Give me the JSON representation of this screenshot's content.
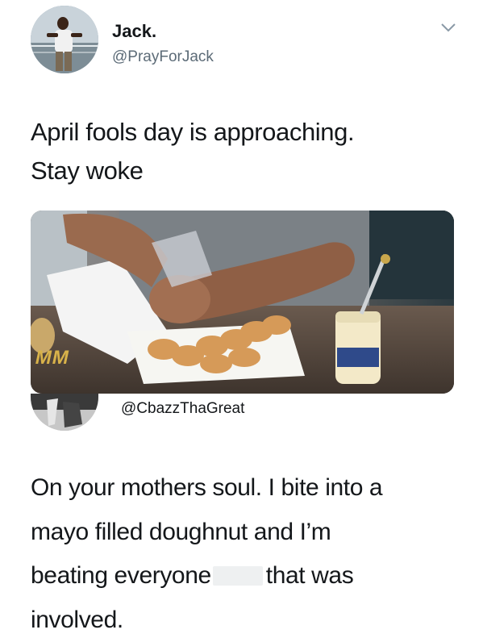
{
  "tweet": {
    "display_name": "Jack.",
    "handle": "@PrayForJack",
    "text_lines": [
      "April fools day is approaching.",
      "Stay woke"
    ],
    "more_icon": "chevron-down-icon"
  },
  "media": {
    "watermark": "MM"
  },
  "reply": {
    "handle": "@CbazzThaGreat",
    "text_lines": [
      "On your mothers soul. I bite into a",
      "mayo filled doughnut and I’m",
      "beating everyone",
      "that was",
      "involved."
    ]
  },
  "colors": {
    "text": "#14171a",
    "secondary": "#5c6b77",
    "redaction": "#eef0f1"
  }
}
